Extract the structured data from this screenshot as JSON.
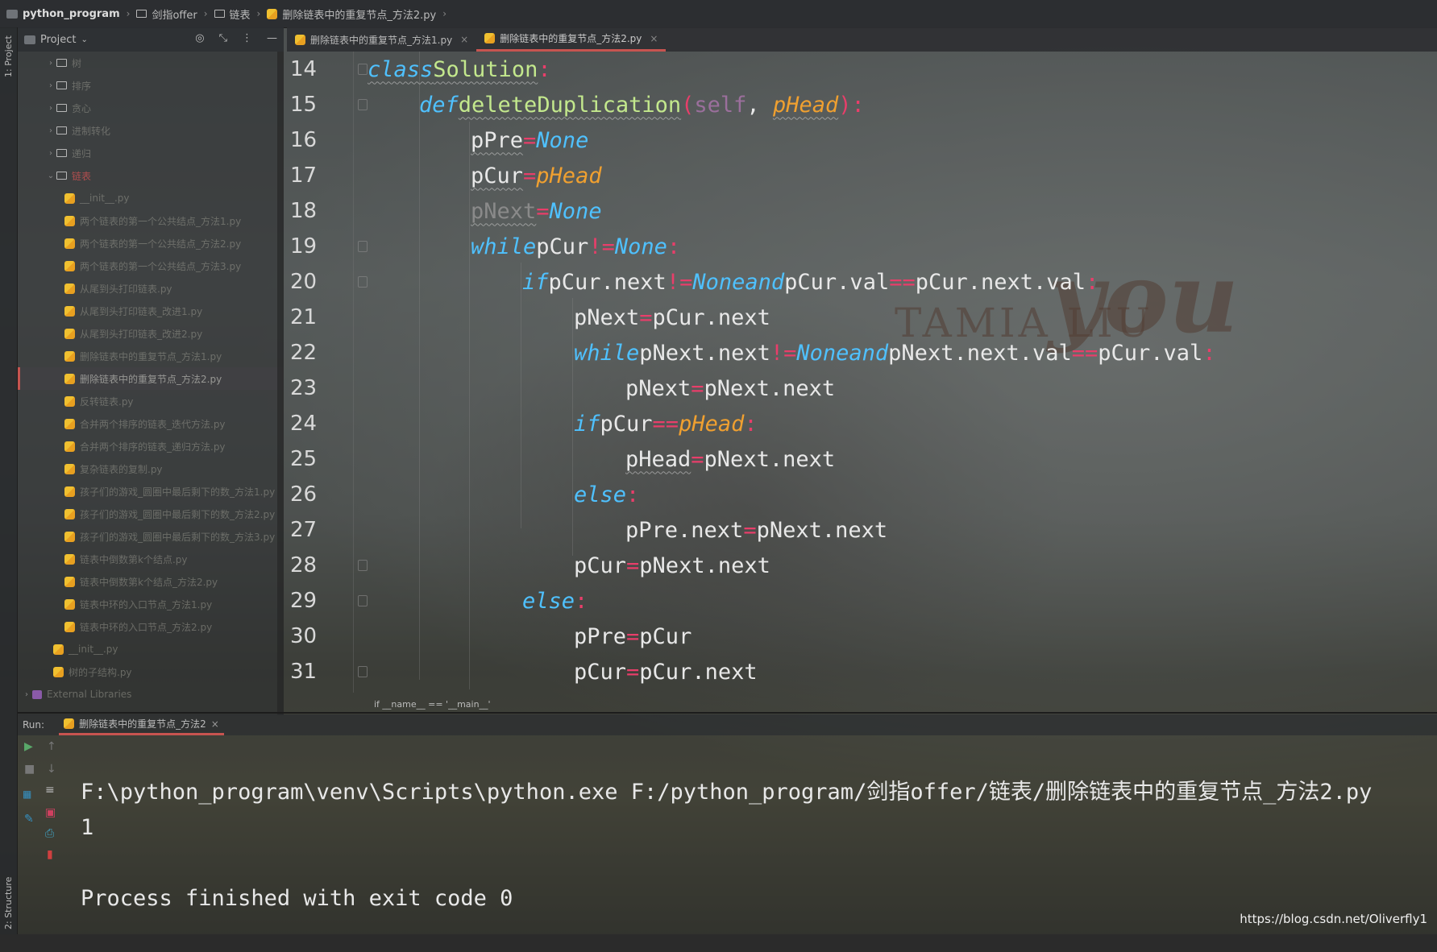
{
  "breadcrumb": {
    "items": [
      "python_program",
      "剑指offer",
      "链表",
      "删除链表中的重复节点_方法2.py"
    ]
  },
  "side_strip": {
    "project_label": "1: Project",
    "structure_label": "2: Structure"
  },
  "project_panel": {
    "title": "Project",
    "tree": [
      {
        "label": "树",
        "type": "folder"
      },
      {
        "label": "排序",
        "type": "folder"
      },
      {
        "label": "贪心",
        "type": "folder"
      },
      {
        "label": "进制转化",
        "type": "folder"
      },
      {
        "label": "递归",
        "type": "folder"
      },
      {
        "label": "链表",
        "type": "folder",
        "expanded": true
      },
      {
        "label": "__init__.py",
        "type": "file"
      },
      {
        "label": "两个链表的第一个公共结点_方法1.py",
        "type": "file"
      },
      {
        "label": "两个链表的第一个公共结点_方法2.py",
        "type": "file"
      },
      {
        "label": "两个链表的第一个公共结点_方法3.py",
        "type": "file"
      },
      {
        "label": "从尾到头打印链表.py",
        "type": "file"
      },
      {
        "label": "从尾到头打印链表_改进1.py",
        "type": "file"
      },
      {
        "label": "从尾到头打印链表_改进2.py",
        "type": "file"
      },
      {
        "label": "删除链表中的重复节点_方法1.py",
        "type": "file"
      },
      {
        "label": "删除链表中的重复节点_方法2.py",
        "type": "file",
        "selected": true
      },
      {
        "label": "反转链表.py",
        "type": "file"
      },
      {
        "label": "合并两个排序的链表_迭代方法.py",
        "type": "file"
      },
      {
        "label": "合并两个排序的链表_递归方法.py",
        "type": "file"
      },
      {
        "label": "复杂链表的复制.py",
        "type": "file"
      },
      {
        "label": "孩子们的游戏_圆圈中最后剩下的数_方法1.py",
        "type": "file"
      },
      {
        "label": "孩子们的游戏_圆圈中最后剩下的数_方法2.py",
        "type": "file"
      },
      {
        "label": "孩子们的游戏_圆圈中最后剩下的数_方法3.py",
        "type": "file"
      },
      {
        "label": "链表中倒数第k个结点.py",
        "type": "file"
      },
      {
        "label": "链表中倒数第k个结点_方法2.py",
        "type": "file"
      },
      {
        "label": "链表中环的入口节点_方法1.py",
        "type": "file"
      },
      {
        "label": "链表中环的入口节点_方法2.py",
        "type": "file"
      },
      {
        "label": "__init__.py",
        "type": "file",
        "level": 1
      },
      {
        "label": "树的子结构.py",
        "type": "file",
        "level": 1
      },
      {
        "label": "External Libraries",
        "type": "lib"
      }
    ]
  },
  "editor_tabs": [
    {
      "label": "删除链表中的重复节点_方法1.py",
      "active": false
    },
    {
      "label": "删除链表中的重复节点_方法2.py",
      "active": true
    }
  ],
  "code": {
    "line_numbers": [
      "14",
      "15",
      "16",
      "17",
      "18",
      "19",
      "20",
      "21",
      "22",
      "23",
      "24",
      "25",
      "26",
      "27",
      "28",
      "29",
      "30",
      "31"
    ],
    "bottom_breadcrumb": "if __name__ == '__main__'"
  },
  "run_panel": {
    "label": "Run:",
    "tab": "删除链表中的重复节点_方法2",
    "output": [
      "F:\\python_program\\venv\\Scripts\\python.exe F:/python_program/剑指offer/链表/删除链表中的重复节点_方法2.py",
      "1",
      "",
      "Process finished with exit code 0"
    ]
  },
  "watermark": "https://blog.csdn.net/Oliverfly1",
  "background_text": {
    "name": "TAMIA LIU",
    "script": "you"
  },
  "colors": {
    "keyword": "#4fc1ff",
    "function": "#c3e88d",
    "operator": "#e83e6a",
    "param": "#f0a030",
    "accent": "#c75450"
  }
}
